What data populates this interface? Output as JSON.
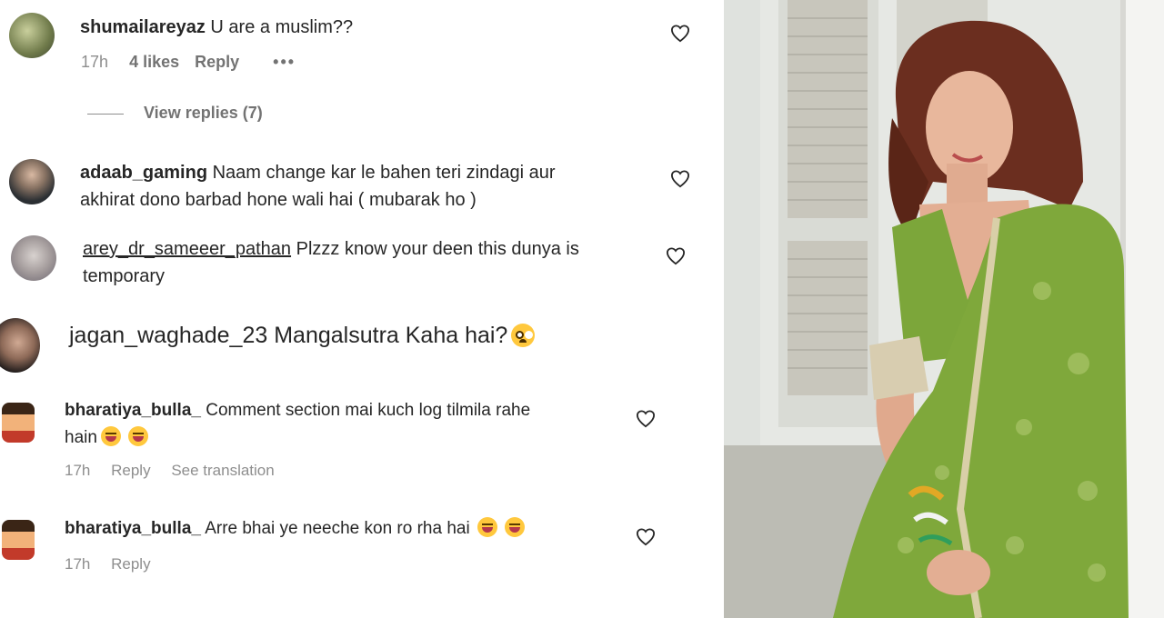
{
  "comments": [
    {
      "username": "shumailareyaz",
      "text": "U are a muslim??",
      "time": "17h",
      "likes": "4 likes",
      "reply": "Reply",
      "more": "•••",
      "view_replies": "View replies (7)"
    },
    {
      "username": "adaab_gaming",
      "text_line1": "Naam change kar le bahen teri zindagi aur",
      "text_line2": "akhirat dono barbad hone wali hai ( mubarak ho )"
    },
    {
      "username": "arey_dr_sameeer_pathan",
      "text_line1": "Plzzz know your deen this dunya is",
      "text_line2": "temporary"
    },
    {
      "username": "jagan_waghade_23",
      "text": "Mangalsutra Kaha hai?"
    },
    {
      "username": "bharatiya_bulla_",
      "text_line1": "Comment section mai kuch log tilmila rahe",
      "text_line2": "hain",
      "time": "17h",
      "reply": "Reply",
      "translation": "See translation"
    },
    {
      "username": "bharatiya_bulla_",
      "text": "Arre bhai ye neeche kon ro rha hai",
      "time": "17h",
      "reply": "Reply"
    }
  ],
  "icons": {
    "like": "heart-outline-icon",
    "emoji_laugh": "grinning-squinting-face-emoji",
    "emoji_sad": "pleading-face-emoji"
  },
  "colors": {
    "text": "#262626",
    "meta": "#8e8e8e",
    "outfit_green": "#7aa53a",
    "wall": "#e9ebe7"
  }
}
